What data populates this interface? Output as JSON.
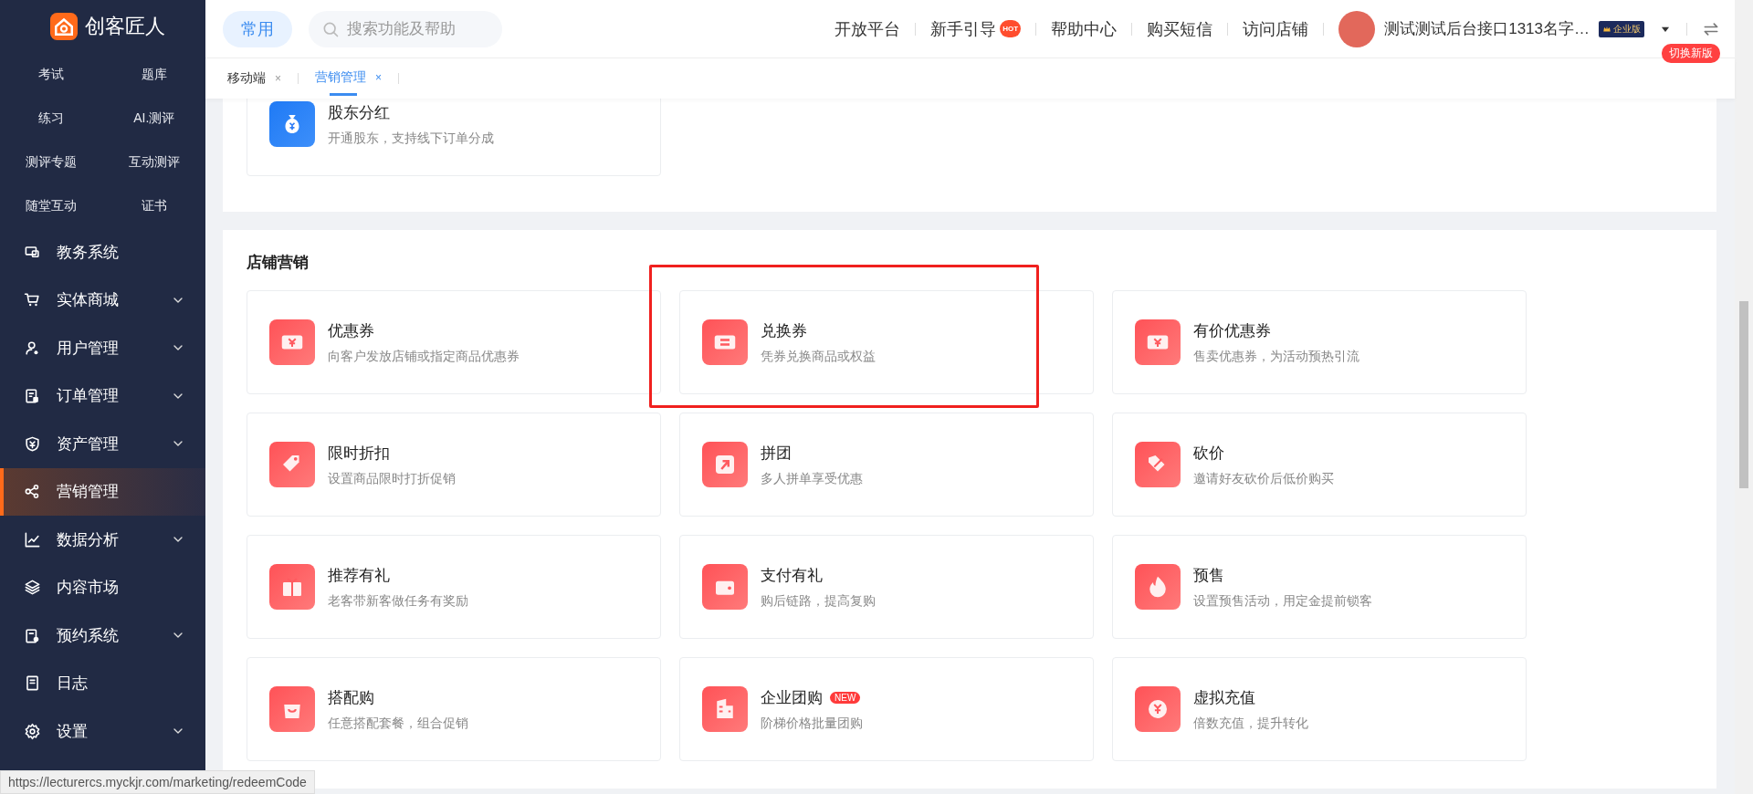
{
  "sidebar": {
    "logo": "创客匠人",
    "sub_items": [
      {
        "label": "考试"
      },
      {
        "label": "题库"
      },
      {
        "label": "练习"
      },
      {
        "label": "AI.测评"
      },
      {
        "label": "测评专题"
      },
      {
        "label": "互动测评"
      },
      {
        "label": "随堂互动"
      },
      {
        "label": "证书"
      }
    ],
    "menu": [
      {
        "label": "教务系统",
        "expandable": false,
        "selected": false
      },
      {
        "label": "实体商城",
        "expandable": true,
        "selected": false
      },
      {
        "label": "用户管理",
        "expandable": true,
        "selected": false
      },
      {
        "label": "订单管理",
        "expandable": true,
        "selected": false
      },
      {
        "label": "资产管理",
        "expandable": true,
        "selected": false
      },
      {
        "label": "营销管理",
        "expandable": false,
        "selected": true
      },
      {
        "label": "数据分析",
        "expandable": true,
        "selected": false
      },
      {
        "label": "内容市场",
        "expandable": false,
        "selected": false
      },
      {
        "label": "预约系统",
        "expandable": true,
        "selected": false
      },
      {
        "label": "日志",
        "expandable": false,
        "selected": false
      },
      {
        "label": "设置",
        "expandable": true,
        "selected": false
      }
    ]
  },
  "topbar": {
    "pill": "常用",
    "search": {
      "placeholder": "搜索功能及帮助"
    },
    "links": [
      {
        "label": "开放平台"
      },
      {
        "label": "新手引导",
        "badge": "HOT"
      },
      {
        "label": "帮助中心"
      },
      {
        "label": "购买短信"
      },
      {
        "label": "访问店铺"
      }
    ],
    "account": {
      "name": "测试测试后台接口1313名字…",
      "edition": "企业版",
      "switch_badge": "切换新版"
    }
  },
  "tabs": [
    {
      "label": "移动端",
      "close": "×",
      "selected": false
    },
    {
      "label": "营销管理",
      "close": "×",
      "selected": true
    }
  ],
  "sections": [
    {
      "cards": [
        {
          "title": "股东分红",
          "desc": "开通股东，支持线下订单分成",
          "highlighted": false
        }
      ]
    },
    {
      "title": "店铺营销",
      "cards": [
        {
          "title": "优惠券",
          "desc": "向客户发放店铺或指定商品优惠券",
          "highlighted": false
        },
        {
          "title": "兑换券",
          "desc": "凭券兑换商品或权益",
          "highlighted": true
        },
        {
          "title": "有价优惠券",
          "desc": "售卖优惠券，为活动预热引流",
          "highlighted": false
        },
        {
          "title": "限时折扣",
          "desc": "设置商品限时打折促销",
          "highlighted": false
        },
        {
          "title": "拼团",
          "desc": "多人拼单享受优惠",
          "highlighted": false
        },
        {
          "title": "砍价",
          "desc": "邀请好友砍价后低价购买",
          "highlighted": false
        },
        {
          "title": "推荐有礼",
          "desc": "老客带新客做任务有奖励",
          "highlighted": false
        },
        {
          "title": "支付有礼",
          "desc": "购后链路，提高复购",
          "highlighted": false
        },
        {
          "title": "预售",
          "desc": "设置预售活动，用定金提前锁客",
          "highlighted": false
        },
        {
          "title": "搭配购",
          "desc": "任意搭配套餐，组合促销",
          "highlighted": false
        },
        {
          "title": "企业团购",
          "desc": "阶梯价格批量团购",
          "badge": "NEW",
          "highlighted": false
        },
        {
          "title": "虚拟充值",
          "desc": "倍数充值，提升转化",
          "highlighted": false
        }
      ]
    }
  ],
  "status_url": "https://lecturercs.myckjr.com/marketing/redeemCode"
}
